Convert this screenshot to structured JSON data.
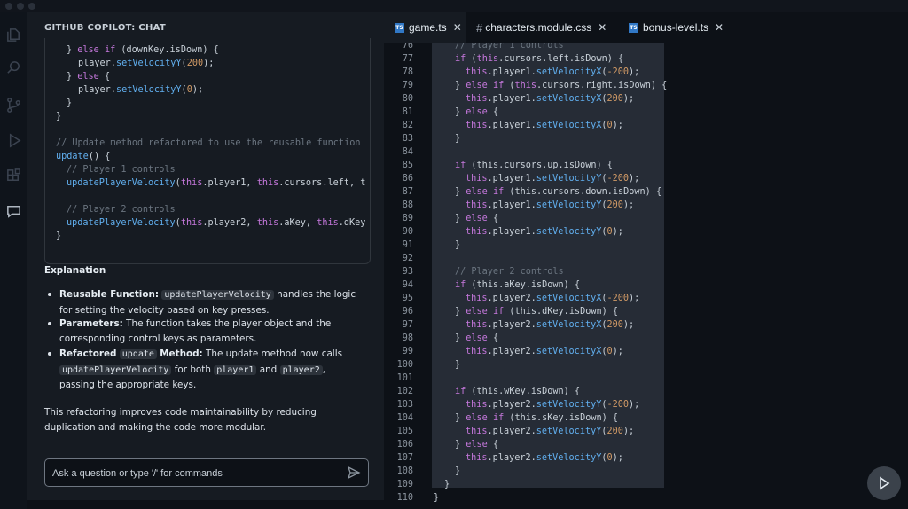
{
  "panel": {
    "title": "GITHUB COPILOT: CHAT"
  },
  "chat_code": [
    [
      [
        "pl",
        "} "
      ],
      [
        "k",
        "else if"
      ],
      [
        "pl",
        " (downKey.isDown) {"
      ]
    ],
    [
      [
        "pl",
        "player."
      ],
      [
        "f",
        "setVelocityY"
      ],
      [
        "pl",
        "("
      ],
      [
        "n",
        "200"
      ],
      [
        "pl",
        ");"
      ]
    ],
    [
      [
        "pl",
        "} "
      ],
      [
        "k",
        "else"
      ],
      [
        "pl",
        " {"
      ]
    ],
    [
      [
        "pl",
        "player."
      ],
      [
        "f",
        "setVelocityY"
      ],
      [
        "pl",
        "("
      ],
      [
        "n",
        "0"
      ],
      [
        "pl",
        ");"
      ]
    ],
    [
      [
        "pl",
        "}"
      ]
    ],
    [
      [
        "pl",
        "}"
      ]
    ],
    [
      [
        "pl",
        ""
      ]
    ],
    [
      [
        "c",
        "// Update method refactored to use the reusable function"
      ]
    ],
    [
      [
        "f",
        "update"
      ],
      [
        "pl",
        "() {"
      ]
    ],
    [
      [
        "c",
        "// Player 1 controls"
      ]
    ],
    [
      [
        "f",
        "updatePlayerVelocity"
      ],
      [
        "pl",
        "("
      ],
      [
        "k",
        "this"
      ],
      [
        "pl",
        ".player1, "
      ],
      [
        "k",
        "this"
      ],
      [
        "pl",
        ".cursors.left, t"
      ]
    ],
    [
      [
        "pl",
        ""
      ]
    ],
    [
      [
        "c",
        "// Player 2 controls"
      ]
    ],
    [
      [
        "f",
        "updatePlayerVelocity"
      ],
      [
        "pl",
        "("
      ],
      [
        "k",
        "this"
      ],
      [
        "pl",
        ".player2, "
      ],
      [
        "k",
        "this"
      ],
      [
        "pl",
        ".aKey, "
      ],
      [
        "k",
        "this"
      ],
      [
        "pl",
        ".dKey"
      ]
    ],
    [
      [
        "pl",
        "}"
      ]
    ]
  ],
  "explanation": {
    "heading": "Explanation",
    "b1_term": "Reusable Function:",
    "b1_code": "updatePlayerVelocity",
    "b1_text": "handles the logic",
    "b1_line2": "for setting the velocity based on key presses.",
    "b2_term": "Parameters:",
    "b2_text": "The function takes the player object and the",
    "b2_line2": "corresponding control keys as parameters.",
    "b3_term1": "Refactored",
    "b3_code": "update",
    "b3_term2": "Method:",
    "b3_text": "The update method now calls",
    "b3_code2": "updatePlayerVelocity",
    "b3_mid": "for both",
    "b3_code3": "player1",
    "b3_and": "and",
    "b3_code4": "player2",
    "b3_comma": ",",
    "b3_line3": "passing the appropriate keys.",
    "summary_line1": "This refactoring improves code maintainability by reducing",
    "summary_line2": "duplication and making the code more modular."
  },
  "chat_input": {
    "placeholder": "Ask a question or type '/' for commands"
  },
  "tabs": [
    {
      "label": "game.ts",
      "icon": "ts-file-icon"
    },
    {
      "label": "characters.module.css",
      "icon": "hash-icon"
    },
    {
      "label": "bonus-level.ts",
      "icon": "ts-file-icon"
    }
  ],
  "editor_lines": [
    {
      "n": "76",
      "toks": [
        [
          "c",
          "// Player 1 controls"
        ]
      ]
    },
    {
      "n": "77",
      "toks": [
        [
          "k",
          "if"
        ],
        [
          "pl",
          " ("
        ],
        [
          "k",
          "this"
        ],
        [
          "pl",
          ".cursors.left.isDown) {"
        ]
      ]
    },
    {
      "n": "78",
      "toks": [
        [
          "k",
          "this"
        ],
        [
          "pl",
          ".player1."
        ],
        [
          "f",
          "setVelocityX"
        ],
        [
          "pl",
          "("
        ],
        [
          "n",
          "-200"
        ],
        [
          "pl",
          ");"
        ]
      ]
    },
    {
      "n": "79",
      "toks": [
        [
          "pl",
          "} "
        ],
        [
          "k",
          "else if"
        ],
        [
          "pl",
          " ("
        ],
        [
          "k",
          "this"
        ],
        [
          "pl",
          ".cursors.right.isDown) {"
        ]
      ]
    },
    {
      "n": "80",
      "toks": [
        [
          "k",
          "this"
        ],
        [
          "pl",
          ".player1."
        ],
        [
          "f",
          "setVelocityX"
        ],
        [
          "pl",
          "("
        ],
        [
          "n",
          "200"
        ],
        [
          "pl",
          ");"
        ]
      ]
    },
    {
      "n": "81",
      "toks": [
        [
          "pl",
          "} "
        ],
        [
          "k",
          "else"
        ],
        [
          "pl",
          " {"
        ]
      ]
    },
    {
      "n": "82",
      "toks": [
        [
          "k",
          "this"
        ],
        [
          "pl",
          ".player1."
        ],
        [
          "f",
          "setVelocityX"
        ],
        [
          "pl",
          "("
        ],
        [
          "n",
          "0"
        ],
        [
          "pl",
          ");"
        ]
      ]
    },
    {
      "n": "83",
      "toks": [
        [
          "pl",
          "}"
        ]
      ]
    },
    {
      "n": "84",
      "toks": []
    },
    {
      "n": "85",
      "toks": [
        [
          "k",
          "if"
        ],
        [
          "pl",
          " (this.cursors.up.isDown) {"
        ]
      ]
    },
    {
      "n": "86",
      "toks": [
        [
          "k",
          "this"
        ],
        [
          "pl",
          ".player1."
        ],
        [
          "f",
          "setVelocityY"
        ],
        [
          "pl",
          "("
        ],
        [
          "n",
          "-200"
        ],
        [
          "pl",
          ");"
        ]
      ]
    },
    {
      "n": "87",
      "toks": [
        [
          "pl",
          "} "
        ],
        [
          "k",
          "else if"
        ],
        [
          "pl",
          " (this.cursors.down.isDown) {"
        ]
      ]
    },
    {
      "n": "88",
      "toks": [
        [
          "k",
          "this"
        ],
        [
          "pl",
          ".player1."
        ],
        [
          "f",
          "setVelocityY"
        ],
        [
          "pl",
          "("
        ],
        [
          "n",
          "200"
        ],
        [
          "pl",
          ");"
        ]
      ]
    },
    {
      "n": "89",
      "toks": [
        [
          "pl",
          "} "
        ],
        [
          "k",
          "else"
        ],
        [
          "pl",
          " {"
        ]
      ]
    },
    {
      "n": "90",
      "toks": [
        [
          "k",
          "this"
        ],
        [
          "pl",
          ".player1."
        ],
        [
          "f",
          "setVelocityY"
        ],
        [
          "pl",
          "("
        ],
        [
          "n",
          "0"
        ],
        [
          "pl",
          ");"
        ]
      ]
    },
    {
      "n": "91",
      "toks": [
        [
          "pl",
          "}"
        ]
      ]
    },
    {
      "n": "92",
      "toks": []
    },
    {
      "n": "93",
      "toks": [
        [
          "c",
          "// Player 2 controls"
        ]
      ]
    },
    {
      "n": "94",
      "toks": [
        [
          "k",
          "if"
        ],
        [
          "pl",
          " (this.aKey.isDown) {"
        ]
      ]
    },
    {
      "n": "95",
      "toks": [
        [
          "k",
          "this"
        ],
        [
          "pl",
          ".player2."
        ],
        [
          "f",
          "setVelocityX"
        ],
        [
          "pl",
          "("
        ],
        [
          "n",
          "-200"
        ],
        [
          "pl",
          ");"
        ]
      ]
    },
    {
      "n": "96",
      "toks": [
        [
          "pl",
          "} "
        ],
        [
          "k",
          "else if"
        ],
        [
          "pl",
          " (this.dKey.isDown) {"
        ]
      ]
    },
    {
      "n": "97",
      "toks": [
        [
          "k",
          "this"
        ],
        [
          "pl",
          ".player2."
        ],
        [
          "f",
          "setVelocityX"
        ],
        [
          "pl",
          "("
        ],
        [
          "n",
          "200"
        ],
        [
          "pl",
          ");"
        ]
      ]
    },
    {
      "n": "98",
      "toks": [
        [
          "pl",
          "} "
        ],
        [
          "k",
          "else"
        ],
        [
          "pl",
          " {"
        ]
      ]
    },
    {
      "n": "99",
      "toks": [
        [
          "k",
          "this"
        ],
        [
          "pl",
          ".player2."
        ],
        [
          "f",
          "setVelocityX"
        ],
        [
          "pl",
          "("
        ],
        [
          "n",
          "0"
        ],
        [
          "pl",
          ");"
        ]
      ]
    },
    {
      "n": "100",
      "toks": [
        [
          "pl",
          "}"
        ]
      ]
    },
    {
      "n": "101",
      "toks": []
    },
    {
      "n": "102",
      "toks": [
        [
          "k",
          "if"
        ],
        [
          "pl",
          " (this.wKey.isDown) {"
        ]
      ]
    },
    {
      "n": "103",
      "toks": [
        [
          "k",
          "this"
        ],
        [
          "pl",
          ".player2."
        ],
        [
          "f",
          "setVelocityY"
        ],
        [
          "pl",
          "("
        ],
        [
          "n",
          "-200"
        ],
        [
          "pl",
          ");"
        ]
      ]
    },
    {
      "n": "104",
      "toks": [
        [
          "pl",
          "} "
        ],
        [
          "k",
          "else if"
        ],
        [
          "pl",
          " (this.sKey.isDown) {"
        ]
      ]
    },
    {
      "n": "105",
      "toks": [
        [
          "k",
          "this"
        ],
        [
          "pl",
          ".player2."
        ],
        [
          "f",
          "setVelocityY"
        ],
        [
          "pl",
          "("
        ],
        [
          "n",
          "200"
        ],
        [
          "pl",
          ");"
        ]
      ]
    },
    {
      "n": "106",
      "toks": [
        [
          "pl",
          "} "
        ],
        [
          "k",
          "else"
        ],
        [
          "pl",
          " {"
        ]
      ]
    },
    {
      "n": "107",
      "toks": [
        [
          "k",
          "this"
        ],
        [
          "pl",
          ".player2."
        ],
        [
          "f",
          "setVelocityY"
        ],
        [
          "pl",
          "("
        ],
        [
          "n",
          "0"
        ],
        [
          "pl",
          ");"
        ]
      ]
    },
    {
      "n": "108",
      "toks": [
        [
          "pl",
          "}"
        ]
      ]
    },
    {
      "n": "109",
      "toks": [
        [
          "pl",
          "}"
        ]
      ]
    },
    {
      "n": "110",
      "toks": [
        [
          "pl",
          "}"
        ]
      ]
    }
  ],
  "colors": {
    "keyword": "#c678dd",
    "function": "#61afef",
    "number": "#d19a66",
    "comment": "#6b7580",
    "selection": "#262c36",
    "ts_badge": "#3178c6"
  }
}
